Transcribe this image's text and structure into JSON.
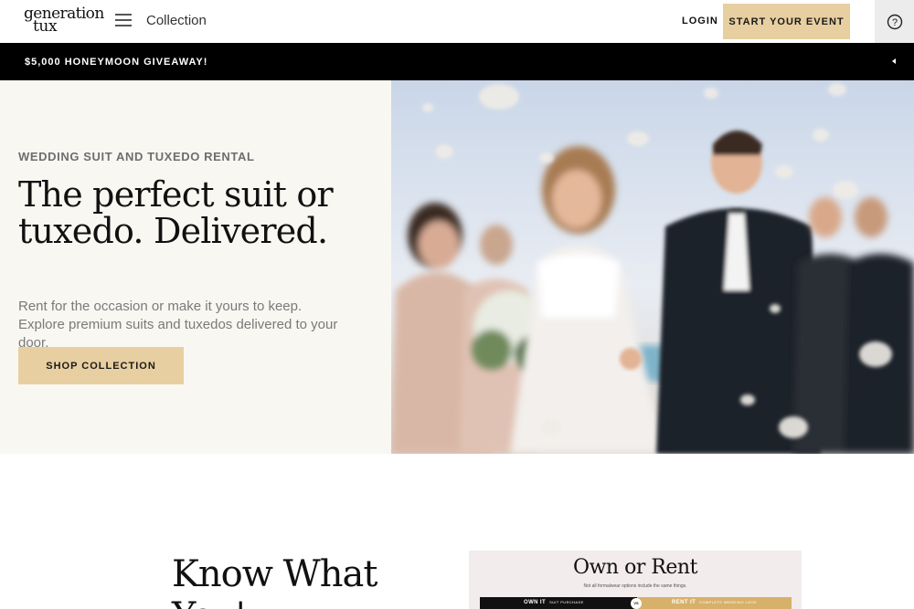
{
  "header": {
    "logo_line1": "generation",
    "logo_line2": "tux",
    "nav_collection": "Collection",
    "login_label": "LOGIN",
    "start_label": "START YOUR EVENT",
    "help_label": "?"
  },
  "promo": {
    "text": "$5,000 HONEYMOON GIVEAWAY!"
  },
  "hero": {
    "eyebrow": "WEDDING SUIT AND TUXEDO RENTAL",
    "headline": "The perfect suit or tuxedo. Delivered.",
    "subtext": "Rent for the occasion or make it yours to keep. Explore premium suits and tuxedos delivered to your door.",
    "cta_label": "SHOP COLLECTION"
  },
  "know": {
    "title_line1": "Know What",
    "title_line2": "You'"
  },
  "own_card": {
    "title": "Own or Rent",
    "subtitle": "Not all formalwear options include the same things.",
    "left_label": "OWN IT",
    "left_small": "SUIT PURCHASE",
    "vs": "VS",
    "right_label": "RENT IT",
    "right_small": "COMPLETE WEDDING LOOK"
  },
  "colors": {
    "accent": "#e8cfa1",
    "promo_bg": "#000000",
    "hero_bg": "#f9f7f2"
  }
}
